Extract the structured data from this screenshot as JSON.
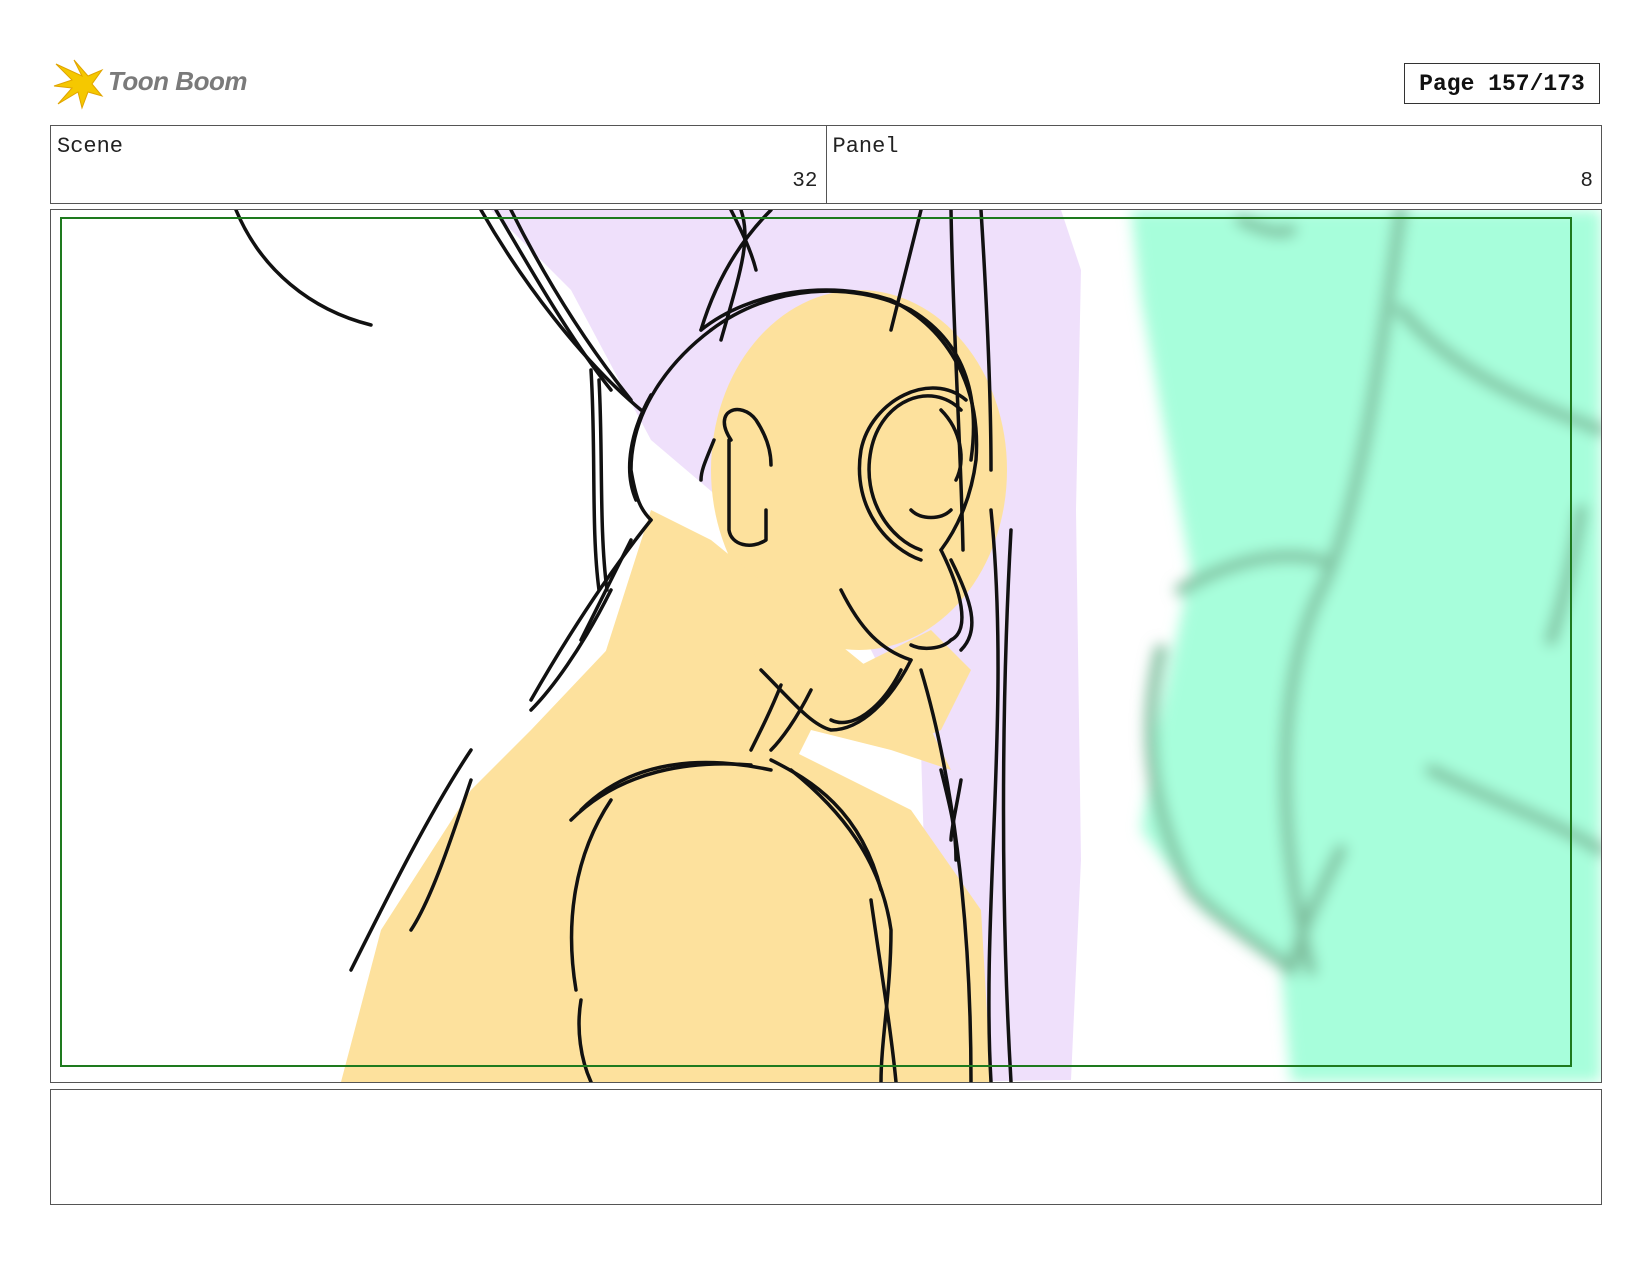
{
  "header": {
    "logo_text": "Toon Boom",
    "page_indicator": "Page 157/173"
  },
  "info_row": {
    "scene_label": "Scene",
    "scene_value": "32",
    "panel_label": "Panel",
    "panel_value": "8"
  },
  "colors": {
    "skin": "#fde19d",
    "hair": "#efe0fb",
    "foreground": "#a7fedb",
    "safe_frame": "#1e7a1e",
    "logo_accent": "#f5c800"
  },
  "notes": {
    "text": ""
  }
}
